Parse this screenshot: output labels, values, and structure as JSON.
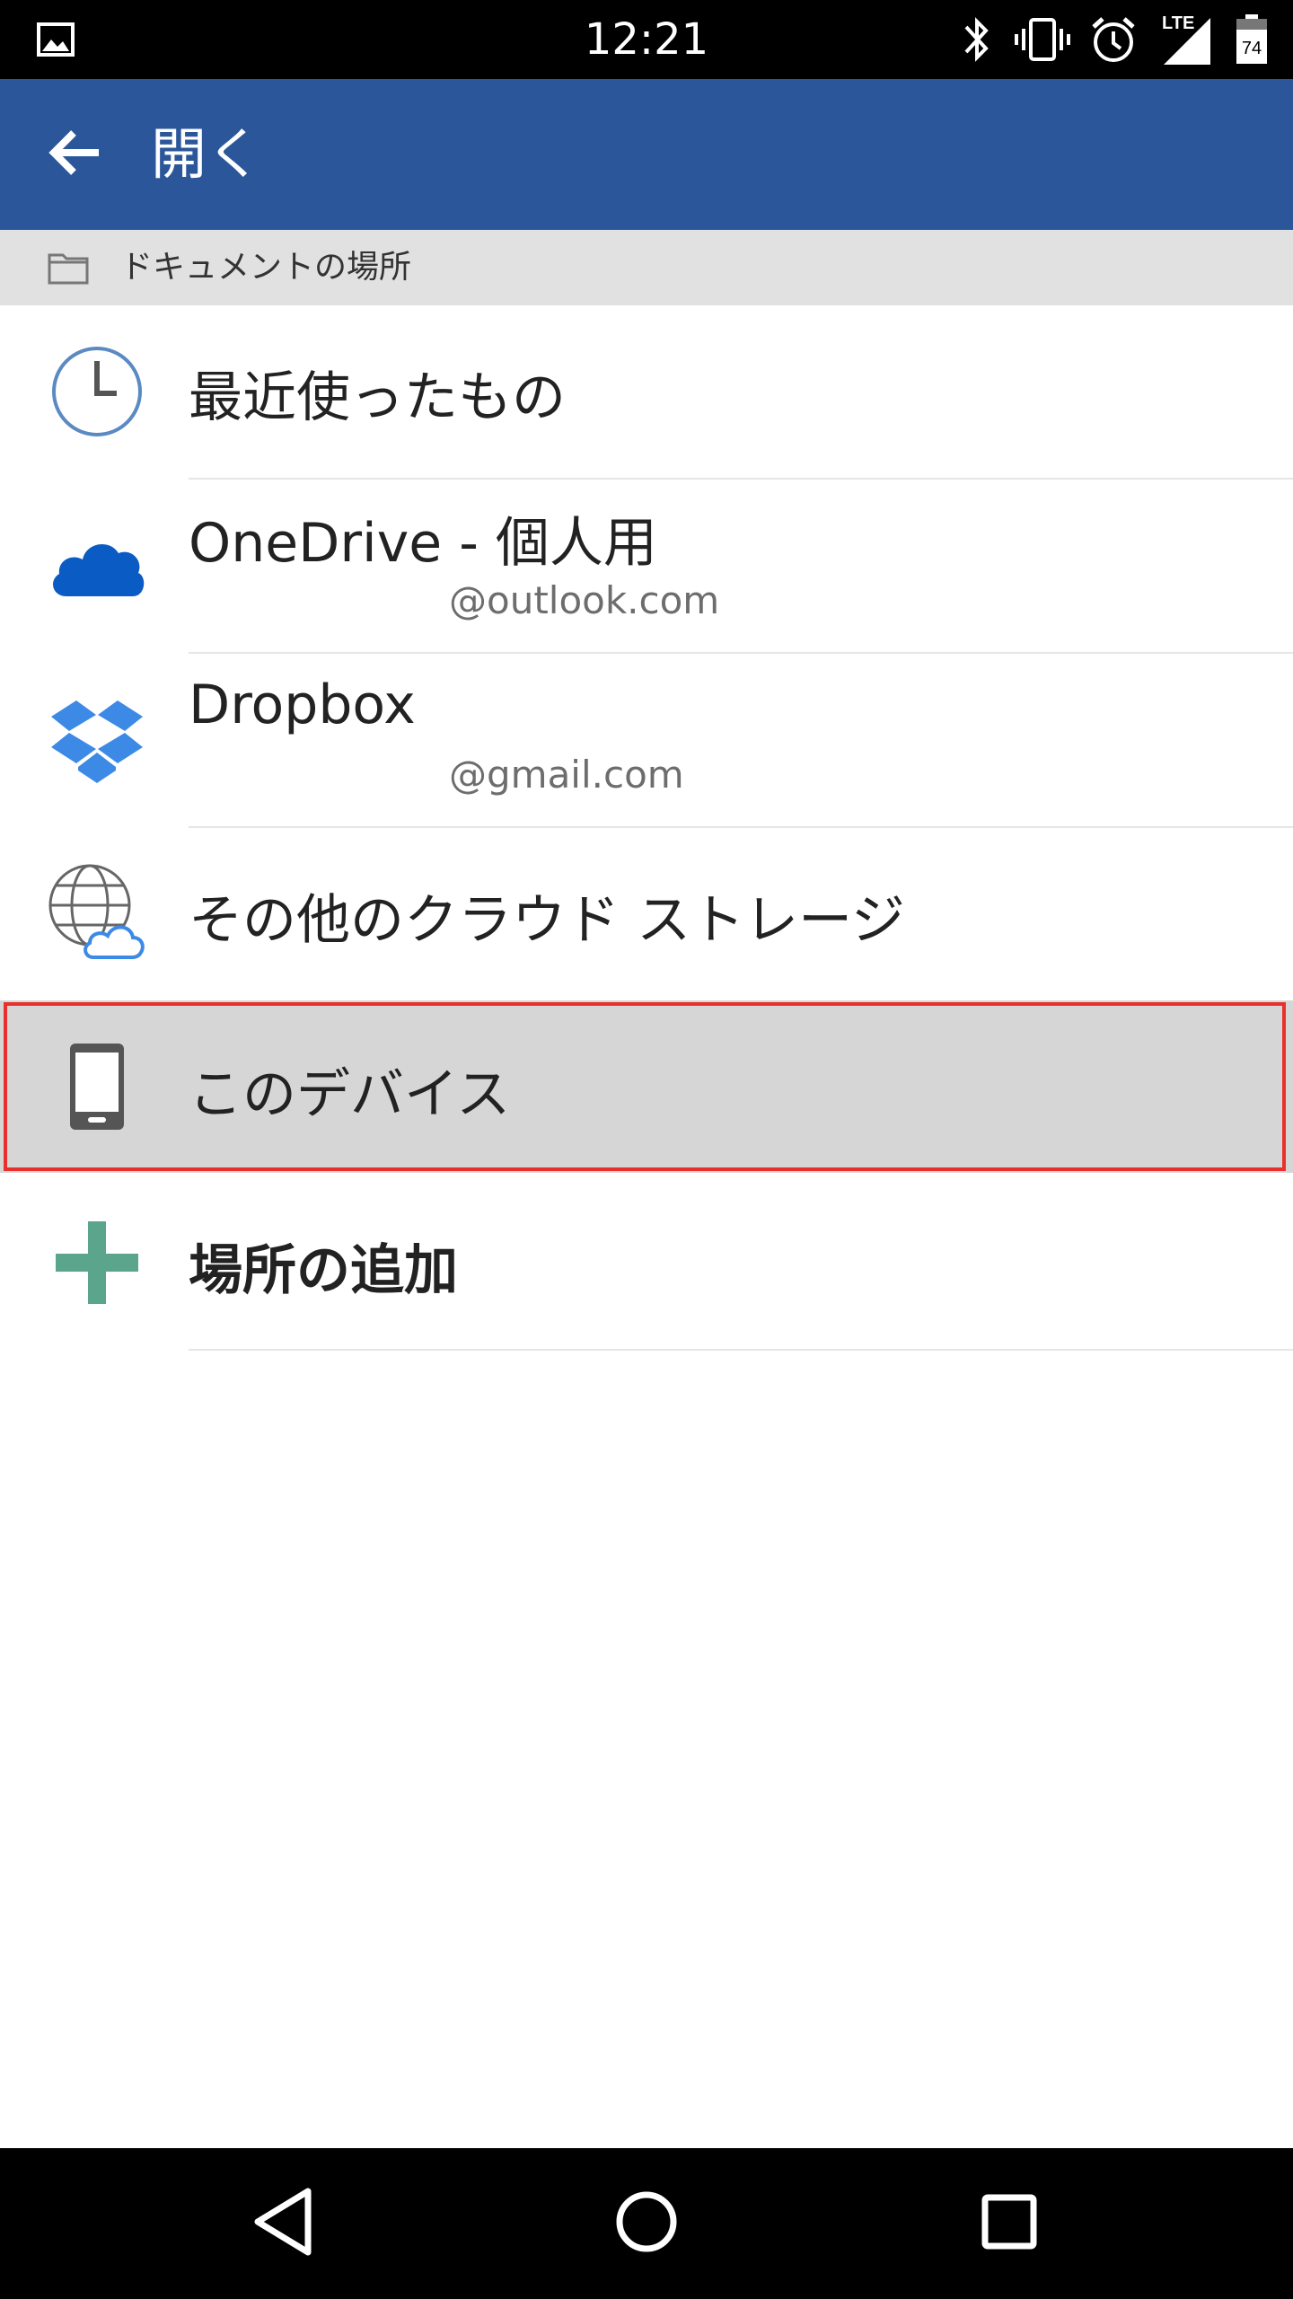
{
  "status_bar": {
    "time": "12:21",
    "network": "LTE",
    "battery": "74",
    "icons": [
      "image-icon",
      "bluetooth-icon",
      "vibrate-icon",
      "alarm-icon",
      "signal-icon",
      "battery-icon"
    ]
  },
  "app_bar": {
    "title": "開く",
    "back_icon": "arrow-left-icon",
    "color": "#2b579a"
  },
  "section": {
    "label": "ドキュメントの場所",
    "icon": "folder-icon"
  },
  "locations": [
    {
      "label": "最近使ったもの",
      "sub": "",
      "icon": "clock-icon"
    },
    {
      "label": "OneDrive - 個人用",
      "sub": "@outlook.com",
      "icon": "onedrive-cloud-icon"
    },
    {
      "label": "Dropbox",
      "sub": "@gmail.com",
      "icon": "dropbox-icon"
    },
    {
      "label": "その他のクラウド ストレージ",
      "sub": "",
      "icon": "globe-cloud-icon"
    },
    {
      "label": "このデバイス",
      "sub": "",
      "icon": "phone-icon",
      "selected": true
    },
    {
      "label": "場所の追加",
      "sub": "",
      "icon": "plus-icon"
    }
  ],
  "colors": {
    "onedrive": "#0a5bc4",
    "dropbox": "#3d8ae6",
    "add": "#5aa58c",
    "highlight_border": "#e8312f"
  },
  "nav_bar": {
    "buttons": [
      "back-triangle-icon",
      "home-circle-icon",
      "recents-square-icon"
    ]
  }
}
